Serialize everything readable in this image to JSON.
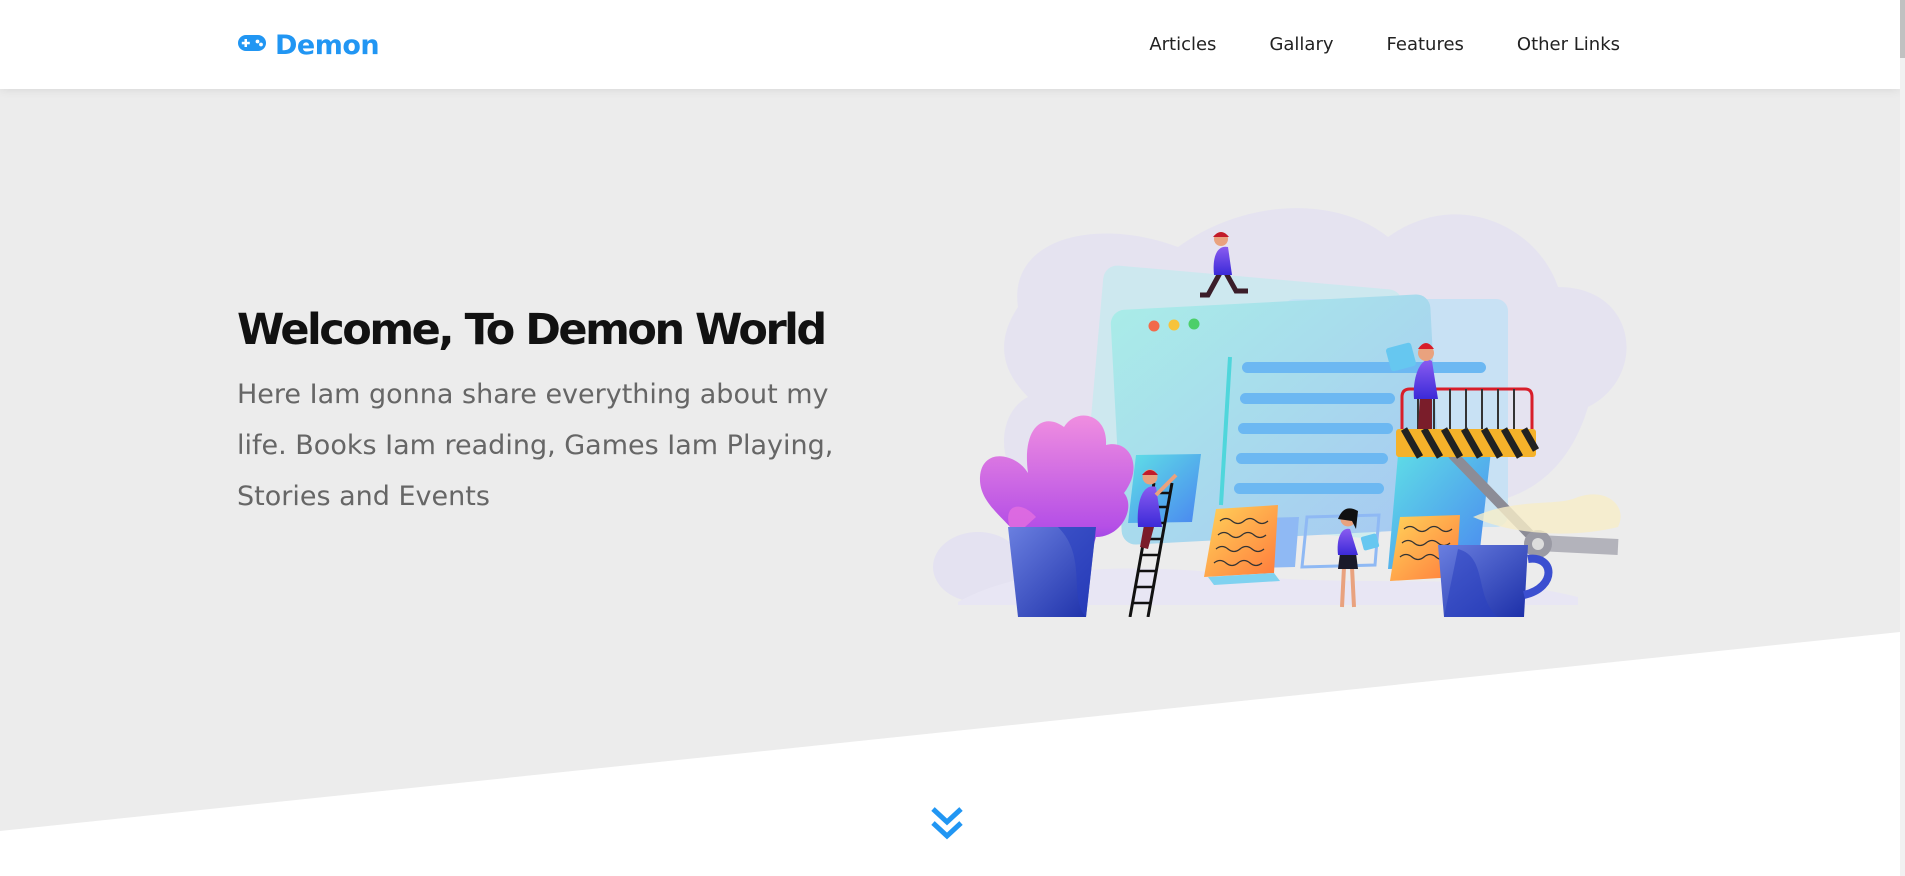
{
  "header": {
    "logo": {
      "icon": "gamepad-icon",
      "text": "Demon"
    },
    "nav": [
      {
        "label": "Articles"
      },
      {
        "label": "Gallary"
      },
      {
        "label": "Features"
      },
      {
        "label": "Other Links"
      }
    ]
  },
  "landing": {
    "title": "Welcome, To Demon World",
    "description": "Here Iam gonna share everything about my life. Books Iam reading, Games Iam Playing, Stories and Events",
    "illustration": "website-building-illustration",
    "scroll_icon": "double-chevron-down-icon"
  },
  "colors": {
    "accent": "#2196f3",
    "hero_background": "#ececec",
    "title": "#111111",
    "description": "#666666"
  }
}
